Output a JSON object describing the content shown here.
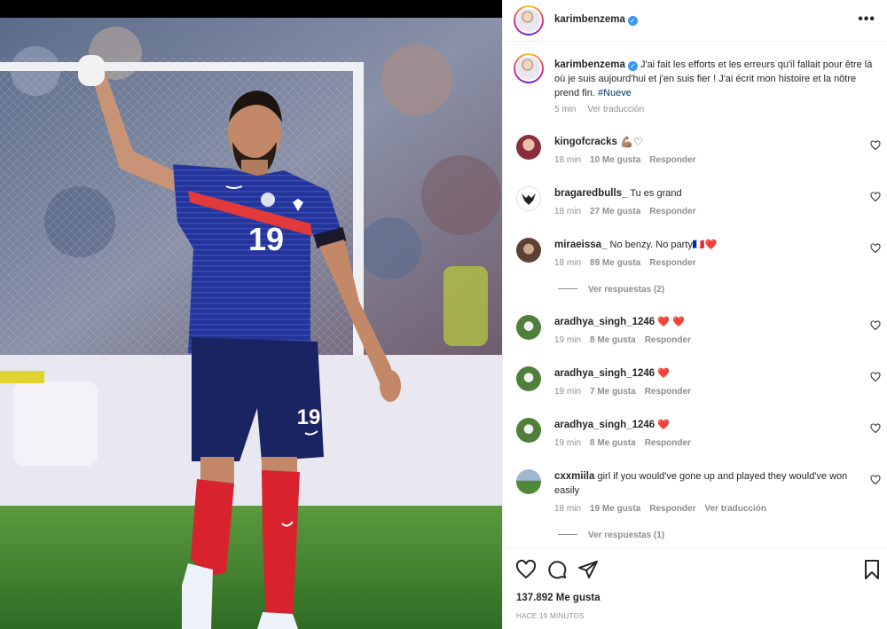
{
  "post": {
    "username": "karimbenzema",
    "verified_badge": "✓",
    "more_label": "•••"
  },
  "caption": {
    "username": "karimbenzema",
    "text": "J'ai fait les efforts et les erreurs qu'il fallait pour être là où je suis aujourd'hui et j'en suis fier ! J'ai écrit mon histoire et la nôtre prend fin.",
    "hashtag": "#Nueve",
    "time": "5 min",
    "translate": "Ver traducción"
  },
  "comments": [
    {
      "username": "kingofcracks",
      "text": "💪🏽♡",
      "time": "18 min",
      "likes": "10 Me gusta",
      "reply": "Responder",
      "translate": ""
    },
    {
      "username": "bragaredbulls_",
      "text": "Tu es grand",
      "time": "18 min",
      "likes": "27 Me gusta",
      "reply": "Responder",
      "translate": ""
    },
    {
      "username": "miraeissa_",
      "text": "No benzy. No party🇫🇷❤️",
      "time": "18 min",
      "likes": "89 Me gusta",
      "reply": "Responder",
      "translate": ""
    },
    {
      "username": "aradhya_singh_1246",
      "text": "❤️ ❤️",
      "time": "19 min",
      "likes": "8 Me gusta",
      "reply": "Responder",
      "translate": ""
    },
    {
      "username": "aradhya_singh_1246",
      "text": "❤️",
      "time": "19 min",
      "likes": "7 Me gusta",
      "reply": "Responder",
      "translate": ""
    },
    {
      "username": "aradhya_singh_1246",
      "text": "❤️",
      "time": "19 min",
      "likes": "8 Me gusta",
      "reply": "Responder",
      "translate": ""
    },
    {
      "username": "cxxmiila",
      "text": "girl if you would've gone up and played they would've won easily",
      "time": "18 min",
      "likes": "19 Me gusta",
      "reply": "Responder",
      "translate": "Ver traducción"
    }
  ],
  "replies": [
    {
      "label": "Ver respuestas (2)"
    },
    {
      "label": "Ver respuestas (1)"
    }
  ],
  "footer": {
    "likes": "137.892 Me gusta",
    "time_ago": "HACE 19 MINUTOS"
  },
  "photo": {
    "jersey_number": "19",
    "shorts_number": "19"
  },
  "colors": {
    "jersey": "#1e2f8c",
    "shorts": "#1a2564",
    "socks": "#d8232e",
    "grass": "#3f7f2e",
    "link": "#00376b",
    "heart": "#ed4956",
    "verified": "#3897f0"
  }
}
